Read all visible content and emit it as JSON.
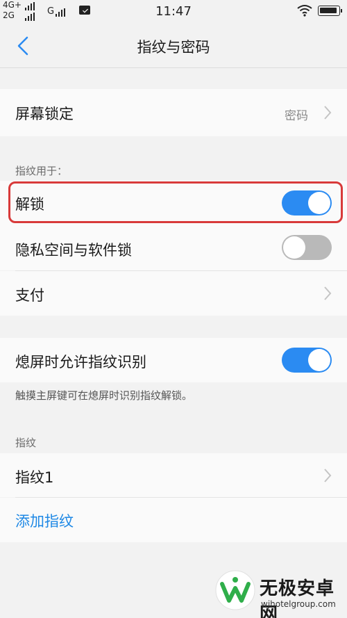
{
  "status_bar": {
    "net_line1": "4G+",
    "net_line2": "2G",
    "net_g": "G",
    "time": "11:47"
  },
  "header": {
    "title": "指纹与密码"
  },
  "screen_lock": {
    "label": "屏幕锁定",
    "value": "密码"
  },
  "fingerprint_use": {
    "section_label": "指纹用于：",
    "unlock_label": "解锁",
    "unlock_on": true,
    "privacy_label": "隐私空间与软件锁",
    "privacy_on": false,
    "payment_label": "支付"
  },
  "screen_off": {
    "label": "熄屏时允许指纹识别",
    "enabled": true,
    "hint": "触摸主屏键可在熄屏时识别指纹解锁。"
  },
  "fingerprints": {
    "section_label": "指纹",
    "items": [
      "指纹1"
    ],
    "add_label": "添加指纹"
  },
  "watermark": {
    "title": "无极安卓网",
    "url": "wjhotelgroup.com"
  },
  "colors": {
    "accent": "#2b8bf2",
    "highlight": "#d83a3a",
    "link": "#1e88e5"
  }
}
